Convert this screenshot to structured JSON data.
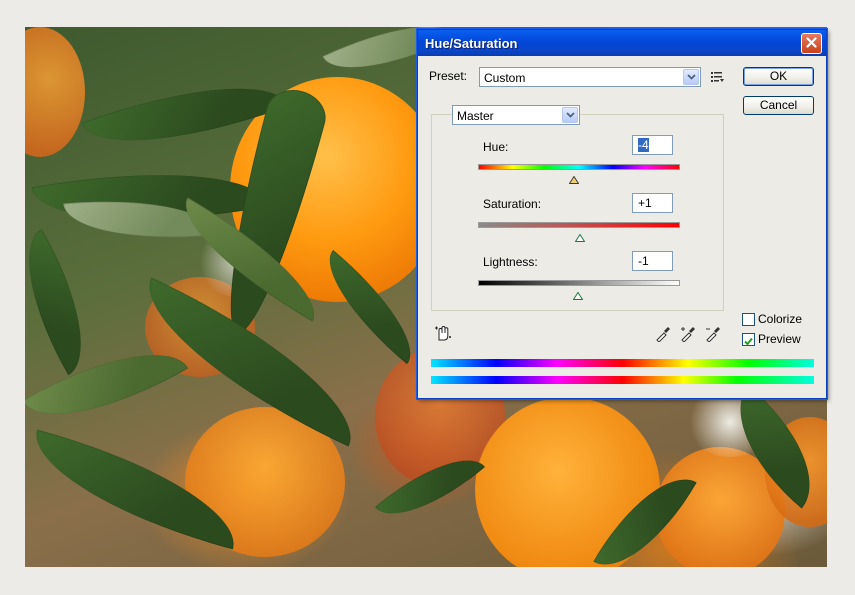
{
  "dialog": {
    "title": "Hue/Saturation",
    "preset_label": "Preset:",
    "preset_value": "Custom",
    "ok_label": "OK",
    "cancel_label": "Cancel",
    "channel_value": "Master",
    "hue_label": "Hue:",
    "hue_value": "-4",
    "saturation_label": "Saturation:",
    "saturation_value": "+1",
    "lightness_label": "Lightness:",
    "lightness_value": "-1",
    "colorize_label": "Colorize",
    "colorize_checked": false,
    "preview_label": "Preview",
    "preview_checked": true,
    "icons": [
      "preset-options-icon",
      "on-image-adjust-icon",
      "eyedropper-icon",
      "eyedropper-plus-icon",
      "eyedropper-minus-icon",
      "close-icon",
      "chevron-down-icon"
    ]
  },
  "colors": {
    "titlebar": "#0a5ff0",
    "close_button": "#d9532f",
    "selection": "#316ac5"
  }
}
